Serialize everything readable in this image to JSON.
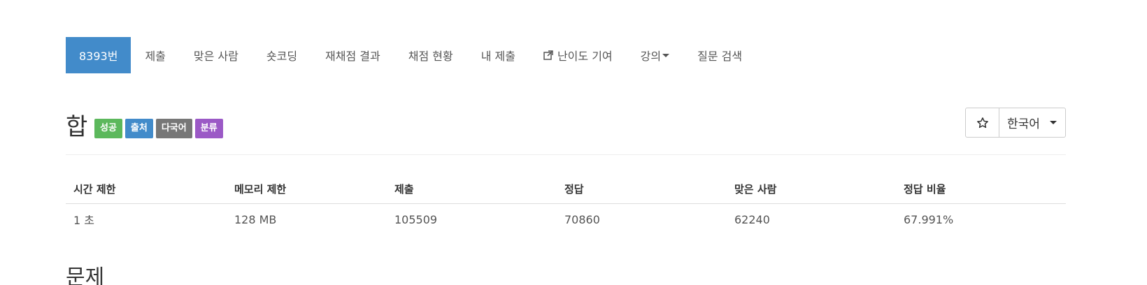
{
  "nav": {
    "items": [
      {
        "label": "8393번"
      },
      {
        "label": "제출"
      },
      {
        "label": "맞은 사람"
      },
      {
        "label": "숏코딩"
      },
      {
        "label": "재채점 결과"
      },
      {
        "label": "채점 현황"
      },
      {
        "label": "내 제출"
      },
      {
        "label": "난이도 기여",
        "icon": "external-link-icon"
      },
      {
        "label": "강의",
        "icon": "caret-down-icon"
      },
      {
        "label": "질문 검색"
      }
    ],
    "active_color": "#428bca"
  },
  "problem": {
    "title": "합",
    "labels": [
      {
        "text": "성공",
        "color": "#5cb85c"
      },
      {
        "text": "출처",
        "color": "#428bca"
      },
      {
        "text": "다국어",
        "color": "#777777"
      },
      {
        "text": "분류",
        "color": "#9b59c6"
      }
    ],
    "star_icon": "star-outline-icon",
    "language": "한국어"
  },
  "info_table": {
    "headers": [
      "시간 제한",
      "메모리 제한",
      "제출",
      "정답",
      "맞은 사람",
      "정답 비율"
    ],
    "row": [
      "1 초",
      "128 MB",
      "105509",
      "70860",
      "62240",
      "67.991%"
    ]
  },
  "section": {
    "title": "문제"
  }
}
